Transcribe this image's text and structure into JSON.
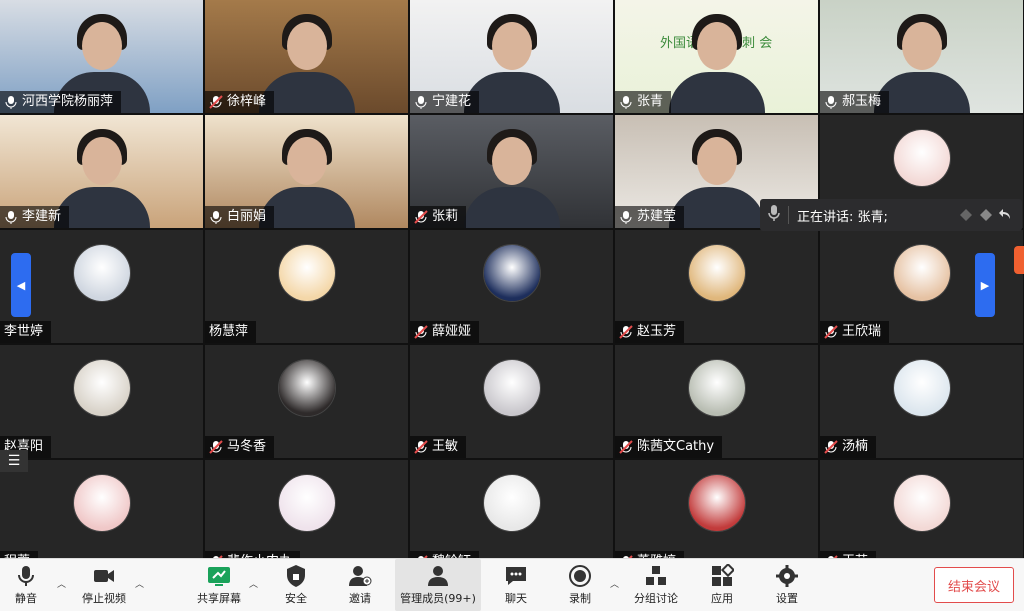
{
  "participants": [
    {
      "name": "河西学院杨丽萍",
      "video": true,
      "muted": false
    },
    {
      "name": "徐梓峰",
      "video": true,
      "muted": true
    },
    {
      "name": "宁建花",
      "video": true,
      "muted": false
    },
    {
      "name": "张青",
      "video": true,
      "muted": false
    },
    {
      "name": "郝玉梅",
      "video": true,
      "muted": false
    },
    {
      "name": "李建新",
      "video": true,
      "muted": false
    },
    {
      "name": "白丽娟",
      "video": true,
      "muted": false
    },
    {
      "name": "张莉",
      "video": true,
      "muted": true
    },
    {
      "name": "苏建莹",
      "video": true,
      "muted": false
    },
    {
      "name": "",
      "video": false,
      "muted": false
    },
    {
      "name": "李世婷",
      "video": false,
      "muted": false
    },
    {
      "name": "杨慧萍",
      "video": false,
      "muted": false
    },
    {
      "name": "薛娅娅",
      "video": false,
      "muted": true
    },
    {
      "name": "赵玉芳",
      "video": false,
      "muted": true
    },
    {
      "name": "王欣瑞",
      "video": false,
      "muted": true
    },
    {
      "name": "赵喜阳",
      "video": false,
      "muted": false
    },
    {
      "name": "马冬香",
      "video": false,
      "muted": true
    },
    {
      "name": "王敏",
      "video": false,
      "muted": true
    },
    {
      "name": "陈茜文Cathy",
      "video": false,
      "muted": true
    },
    {
      "name": "汤楠",
      "video": false,
      "muted": true
    },
    {
      "name": "程蓉",
      "video": false,
      "muted": false
    },
    {
      "name": "裴作小肉丸",
      "video": false,
      "muted": true
    },
    {
      "name": "魏铃钰",
      "video": false,
      "muted": true
    },
    {
      "name": "董雅婷",
      "video": false,
      "muted": true
    },
    {
      "name": "王芸",
      "video": false,
      "muted": true
    }
  ],
  "banner_text": "外国语 考研冲刺 会",
  "speaker": {
    "label": "正在讲话: 张青;"
  },
  "toolbar": {
    "mute": "静音",
    "stop_video": "停止视频",
    "share": "共享屏幕",
    "security": "安全",
    "invite": "邀请",
    "participants": "管理成员(99+)",
    "chat": "聊天",
    "record": "录制",
    "breakout": "分组讨论",
    "apps": "应用",
    "settings": "设置",
    "end": "结束会议"
  },
  "colors": {
    "accent": "#2d6cf0",
    "end": "#e24c4c",
    "share_green": "#1aa25a"
  }
}
